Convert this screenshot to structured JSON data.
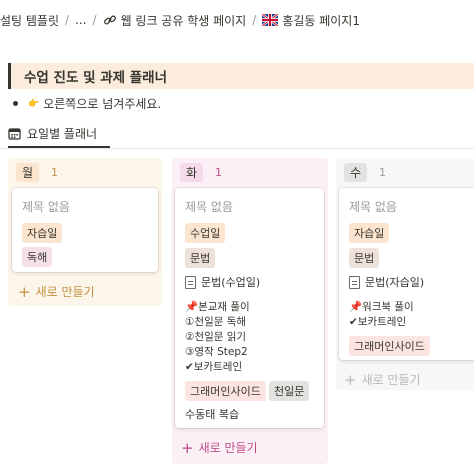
{
  "breadcrumb": [
    {
      "label": "설팅 템플릿",
      "icon": ""
    },
    {
      "label": "...",
      "icon": ""
    },
    {
      "label": "웹 링크 공유 학생 페이지",
      "icon": "link-icon"
    },
    {
      "label": "홍길동 페이지1",
      "icon": "uk-flag-icon"
    }
  ],
  "callout": {
    "title": "수업 진도 및 과제 플래너"
  },
  "bullet": {
    "text": "오른쪽으로 넘겨주세요."
  },
  "view": {
    "label": "요일별 플래너",
    "icon": "calendar-icon"
  },
  "columns": [
    {
      "name": "월",
      "count": "1",
      "new_label": "새로 만들기",
      "card": {
        "title": "제목 없음",
        "tags": [
          "자습일",
          "독해"
        ]
      }
    },
    {
      "name": "화",
      "count": "1",
      "new_label": "새로 만들기",
      "card": {
        "title": "제목 없음",
        "tags": [
          "수업일",
          "문법"
        ],
        "doc": "문법(수업일)",
        "lines": [
          "📌본교재 풀이",
          "①천일문 독해",
          "②천일문 읽기",
          "③영작 Step2",
          "✔보카트레인"
        ],
        "extra_tags": [
          "그래머인사이드",
          "천일문"
        ],
        "footer": "수동태 복습"
      }
    },
    {
      "name": "수",
      "count": "1",
      "new_label": "새로 만들기",
      "card": {
        "title": "제목 없음",
        "tags": [
          "자습일",
          "문법"
        ],
        "doc": "문법(자습일)",
        "lines": [
          "📌워크북 풀이",
          "✔보카트레인"
        ],
        "extra_tags": [
          "그래머인사이드"
        ]
      }
    }
  ],
  "colors": {
    "mon_bg": "#fcf5ea",
    "tue_bg": "#fcf0f7",
    "wed_bg": "#f7f7f6",
    "tag_orange": "#fbe5cf",
    "tag_pink": "#f5e0e9",
    "tag_gray": "#e3e2e0",
    "tag_red": "#fce4e2",
    "tag_beige": "#eee0da",
    "callout_bg": "#fbecdd"
  }
}
